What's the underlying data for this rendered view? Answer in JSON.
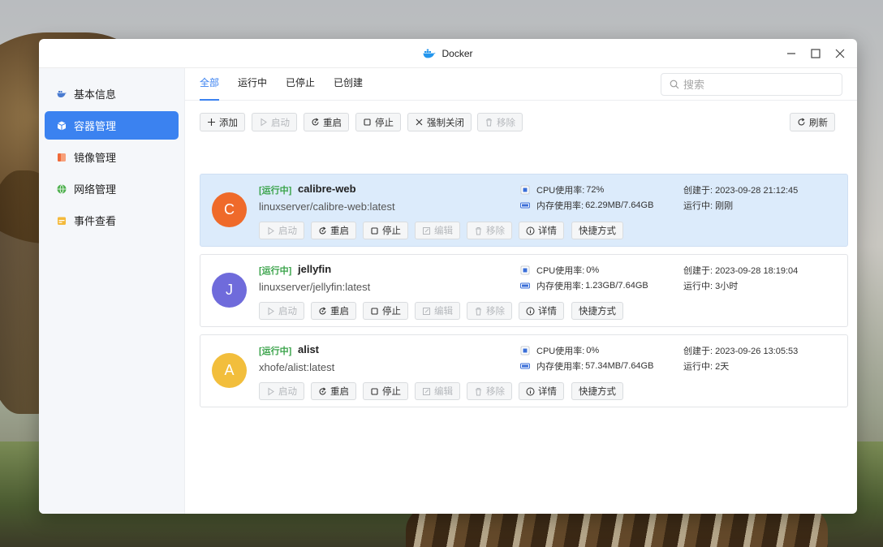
{
  "window": {
    "title": "Docker"
  },
  "sidebar": {
    "items": [
      {
        "label": "基本信息",
        "icon": "docker-icon",
        "active": false
      },
      {
        "label": "容器管理",
        "icon": "cube-icon",
        "active": true
      },
      {
        "label": "镜像管理",
        "icon": "image-icon",
        "active": false
      },
      {
        "label": "网络管理",
        "icon": "globe-icon",
        "active": false
      },
      {
        "label": "事件查看",
        "icon": "calendar-icon",
        "active": false
      }
    ]
  },
  "tabs": [
    {
      "label": "全部",
      "active": true
    },
    {
      "label": "运行中",
      "active": false
    },
    {
      "label": "已停止",
      "active": false
    },
    {
      "label": "已创建",
      "active": false
    }
  ],
  "search": {
    "placeholder": "搜索"
  },
  "toolbar": {
    "add": "添加",
    "start": "启动",
    "restart": "重启",
    "stop": "停止",
    "force_close": "强制关闭",
    "remove": "移除",
    "refresh": "刷新"
  },
  "card_actions": {
    "start": "启动",
    "restart": "重启",
    "stop": "停止",
    "edit": "编辑",
    "remove": "移除",
    "details": "详情",
    "shortcut": "快捷方式"
  },
  "labels": {
    "cpu": "CPU使用率:",
    "memory": "内存使用率:",
    "created": "创建于:",
    "running": "运行中:"
  },
  "containers": [
    {
      "initial": "C",
      "color": "#ef6a2a",
      "status": "[运行中]",
      "name": "calibre-web",
      "image": "linuxserver/calibre-web:latest",
      "cpu": "72%",
      "memory": "62.29MB/7.64GB",
      "created": "2023-09-28 21:12:45",
      "uptime": "刚刚",
      "selected": true
    },
    {
      "initial": "J",
      "color": "#6f6bdb",
      "status": "[运行中]",
      "name": "jellyfin",
      "image": "linuxserver/jellyfin:latest",
      "cpu": "0%",
      "memory": "1.23GB/7.64GB",
      "created": "2023-09-28 18:19:04",
      "uptime": "3小时",
      "selected": false
    },
    {
      "initial": "A",
      "color": "#f2be3c",
      "status": "[运行中]",
      "name": "alist",
      "image": "xhofe/alist:latest",
      "cpu": "0%",
      "memory": "57.34MB/7.64GB",
      "created": "2023-09-26 13:05:53",
      "uptime": "2天",
      "selected": false
    }
  ],
  "colors": {
    "accent": "#3b82f0",
    "running": "#3aa34a"
  }
}
